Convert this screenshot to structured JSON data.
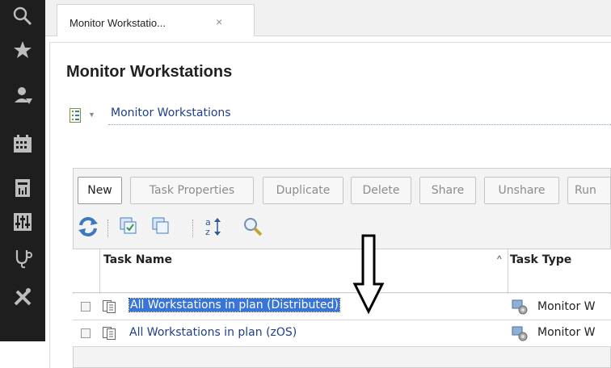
{
  "sidebar": {
    "items": [
      {
        "icon": "search-icon"
      },
      {
        "icon": "star-icon"
      },
      {
        "icon": "user-icon"
      },
      {
        "icon": "calendar-icon"
      },
      {
        "icon": "report-icon"
      },
      {
        "icon": "sliders-icon"
      },
      {
        "icon": "stethoscope-icon"
      },
      {
        "icon": "tools-icon"
      }
    ]
  },
  "tabs": [
    {
      "label": "Monitor Workstatio...",
      "close": "×"
    }
  ],
  "page": {
    "title": "Monitor Workstations",
    "breadcrumb": "Monitor Workstations"
  },
  "toolbar": {
    "buttons": [
      {
        "label": "New",
        "enabled": true
      },
      {
        "label": "Task Properties",
        "enabled": false
      },
      {
        "label": "Duplicate",
        "enabled": false
      },
      {
        "label": "Delete",
        "enabled": false
      },
      {
        "label": "Share",
        "enabled": false
      },
      {
        "label": "Unshare",
        "enabled": false
      },
      {
        "label": "Run",
        "enabled": false
      }
    ],
    "icons": [
      "refresh-icon",
      "select-all-icon",
      "deselect-all-icon",
      "sort-icon",
      "search-icon"
    ]
  },
  "table": {
    "columns": [
      {
        "label": "Task Name",
        "sort": "^"
      },
      {
        "label": "Task Type"
      }
    ],
    "rows": [
      {
        "name": "All Workstations in plan (Distributed)",
        "type": "Monitor W",
        "selected": true
      },
      {
        "name": "All Workstations in plan (zOS)",
        "type": "Monitor W",
        "selected": false
      }
    ]
  },
  "colors": {
    "sidebar_bg": "#1e1e1e",
    "link": "#1f3f8a",
    "selection": "#3875d7"
  }
}
